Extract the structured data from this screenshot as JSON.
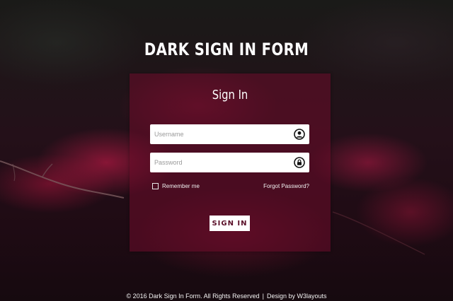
{
  "header": {
    "title": "DARK SIGN IN FORM"
  },
  "form": {
    "title": "Sign In",
    "username_placeholder": "Username",
    "username_value": "",
    "username_icon": "user-circle-icon",
    "password_placeholder": "Password",
    "password_value": "",
    "password_icon": "lock-circle-icon",
    "remember_label": "Remember me",
    "remember_checked": false,
    "forgot_label": "Forgot Password?",
    "submit_label": "SIGN IN"
  },
  "footer": {
    "copyright": "© 2016 Dark Sign In Form. All Rights Reserved",
    "separator": "|",
    "design_prefix": "Design by ",
    "design_link": "W3layouts"
  },
  "colors": {
    "card_bg": "#690c2a",
    "accent_text": "#5a0f28",
    "text": "#ffffff"
  }
}
